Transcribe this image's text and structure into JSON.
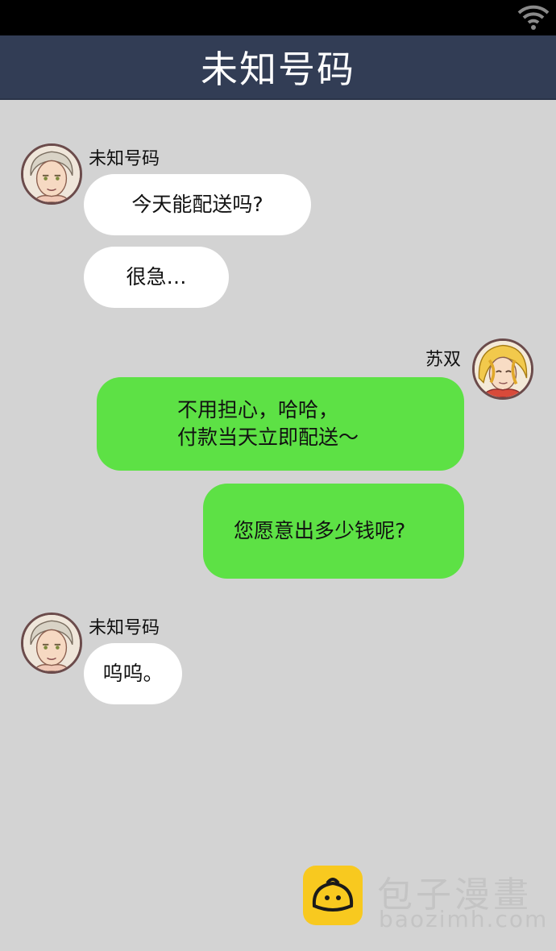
{
  "header": {
    "title": "未知号码"
  },
  "messages": [
    {
      "sender": "未知号码",
      "direction": "in",
      "bubbles": [
        "今天能配送吗?",
        "很急…"
      ]
    },
    {
      "sender": "苏双",
      "direction": "out",
      "bubbles": [
        "不用担心，哈哈，\n付款当天立即配送～",
        "您愿意出多少钱呢?"
      ]
    },
    {
      "sender": "未知号码",
      "direction": "in",
      "bubbles": [
        "呜呜。"
      ]
    }
  ],
  "avatars": {
    "unknown": "man-portrait-avatar",
    "su_shuang": "blonde-portrait-avatar"
  },
  "watermark": {
    "title": "包子漫畫",
    "url": "baozimh.com"
  },
  "colors": {
    "status_bar": "#000000",
    "title_bar": "#323d55",
    "background": "#d3d3d3",
    "incoming_bubble": "#ffffff",
    "outgoing_bubble": "#5de145"
  },
  "icons": {
    "status": "wifi-icon",
    "logo": "bun-logo-icon"
  }
}
